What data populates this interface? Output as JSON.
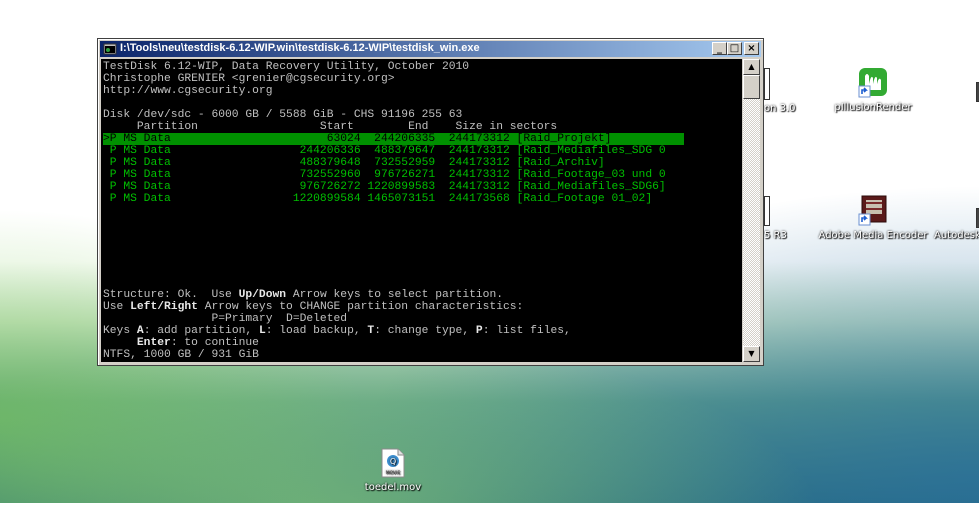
{
  "window": {
    "title": "I:\\Tools\\neu\\testdisk-6.12-WIP.win\\testdisk-6.12-WIP\\testdisk_win.exe",
    "minimize": "_",
    "maximize": "□",
    "close": "×"
  },
  "console": {
    "header1": "TestDisk 6.12-WIP, Data Recovery Utility, October 2010",
    "header2": "Christophe GRENIER <grenier@cgsecurity.org>",
    "header3": "http://www.cgsecurity.org",
    "disk": "Disk /dev/sdc - 6000 GB / 5588 GiB - CHS 91196 255 63",
    "col_header": "     Partition                  Start        End    Size in sectors",
    "partitions": [
      ">P MS Data                       63024  244206335  244173312 [Raid_Projekt]",
      " P MS Data                   244206336  488379647  244173312 [Raid_Mediafiles_SDG 0",
      " P MS Data                   488379648  732552959  244173312 [Raid_Archiv]",
      " P MS Data                   732552960  976726271  244173312 [Raid_Footage_03 und 0",
      " P MS Data                   976726272 1220899583  244173312 [Raid_Mediafiles_SDG6]",
      " P MS Data                  1220899584 1465073151  244173568 [Raid_Footage 01_02]"
    ],
    "status1_a": "Structure: Ok.  Use ",
    "status1_b": "Up/Down",
    "status1_c": " Arrow keys to select partition.",
    "status2_a": "Use ",
    "status2_b": "Left/Right",
    "status2_c": " Arrow keys to CHANGE partition characteristics:",
    "status3": "                P=Primary  D=Deleted",
    "keys_a": "Keys ",
    "keys_b": "A",
    "keys_c": ": add partition, ",
    "keys_d": "L",
    "keys_e": ": load backup, ",
    "keys_f": "T",
    "keys_g": ": change type, ",
    "keys_h": "P",
    "keys_i": ": list files,",
    "enter_a": "     ",
    "enter_b": "Enter",
    "enter_c": ": to continue",
    "fs": "NTFS, 1000 GB / 931 GiB"
  },
  "desktop_icons": {
    "illusion_render": "pIllusionRender",
    "adobe_media_encoder": "Adobe Media Encoder",
    "autodesk": "Autodesk",
    "partial_top": "on 3.0",
    "partial_mid": "5 R3",
    "movie_file": "toedel.mov"
  },
  "colors": {
    "titlebar_start": "#0a246a",
    "selection_bg": "#009000",
    "partition_text": "#00c000"
  }
}
